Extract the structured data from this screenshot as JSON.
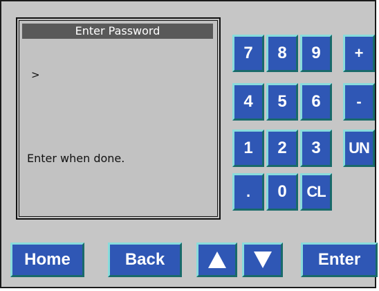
{
  "panel": {
    "title": "Enter Password",
    "prompt": ">",
    "hint": "Enter when done."
  },
  "keypad": {
    "k7": "7",
    "k8": "8",
    "k9": "9",
    "plus": "+",
    "k4": "4",
    "k5": "5",
    "k6": "6",
    "minus": "-",
    "k1": "1",
    "k2": "2",
    "k3": "3",
    "un": "UN",
    "dot": ".",
    "k0": "0",
    "cl": "CL"
  },
  "nav": {
    "home": "Home",
    "back": "Back",
    "up_icon": "arrow-up-icon",
    "down_icon": "arrow-down-icon",
    "enter": "Enter"
  },
  "colors": {
    "background": "#c6c6c6",
    "key_fill": "#2f57b5",
    "key_bevel_light": "#88dcdc",
    "key_bevel_dark": "#196a6a",
    "title_bar": "#595959"
  }
}
